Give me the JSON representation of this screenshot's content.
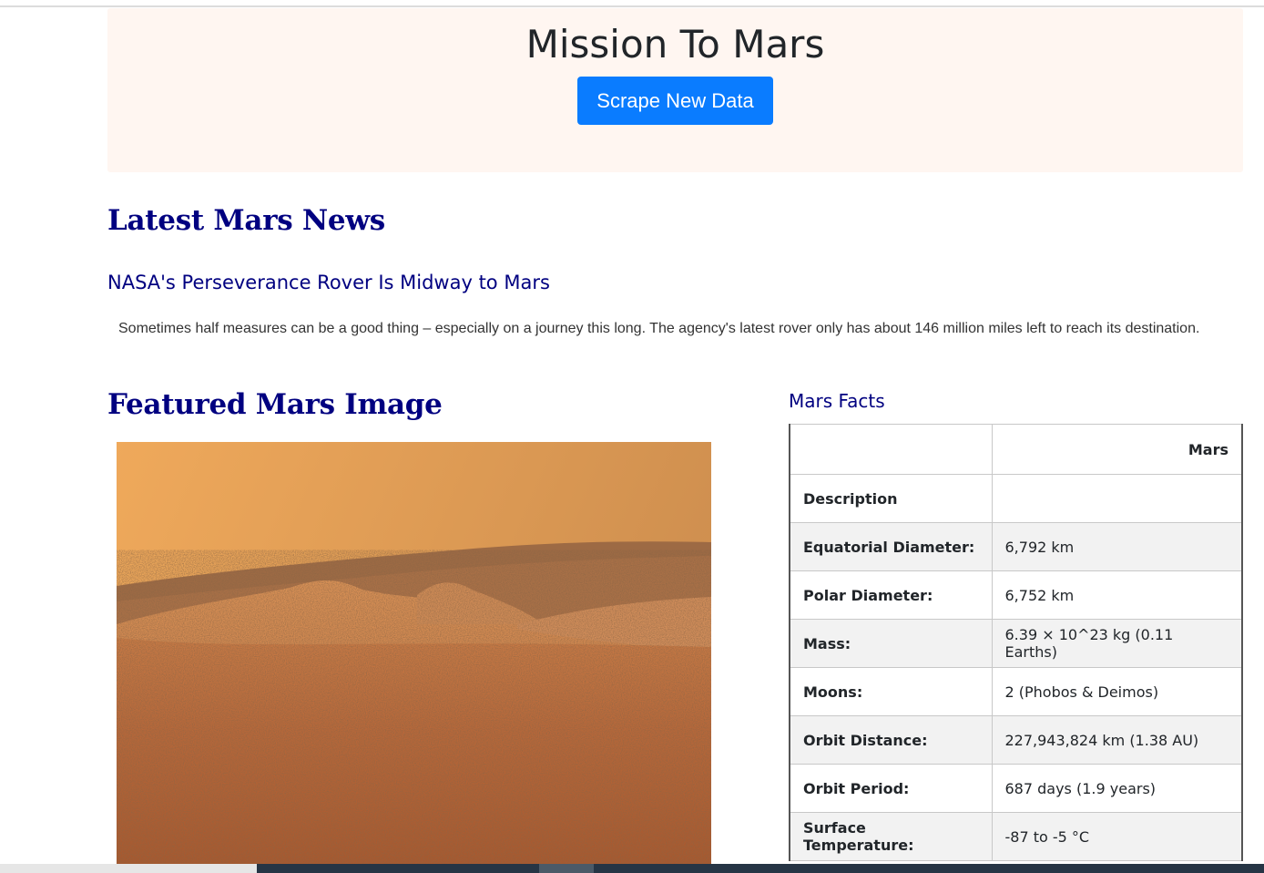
{
  "header": {
    "title": "Mission To Mars",
    "scrape_button": "Scrape New Data"
  },
  "news": {
    "section_title": "Latest Mars News",
    "headline": "NASA's Perseverance Rover Is Midway to Mars",
    "teaser": "Sometimes half measures can be a good thing – especially on a journey this long. The agency's latest rover only has about 146 million miles left to reach its destination."
  },
  "featured": {
    "section_title": "Featured Mars Image"
  },
  "facts": {
    "title": "Mars Facts",
    "column_header": "Mars",
    "rows": [
      {
        "label": "Description",
        "value": ""
      },
      {
        "label": "Equatorial Diameter:",
        "value": "6,792 km"
      },
      {
        "label": "Polar Diameter:",
        "value": "6,752 km"
      },
      {
        "label": "Mass:",
        "value": "6.39 × 10^23 kg (0.11 Earths)"
      },
      {
        "label": "Moons:",
        "value": "2 (Phobos & Deimos)"
      },
      {
        "label": "Orbit Distance:",
        "value": "227,943,824 km (1.38 AU)"
      },
      {
        "label": "Orbit Period:",
        "value": "687 days (1.9 years)"
      },
      {
        "label": "Surface Temperature:",
        "value": "-87 to -5 °C"
      }
    ]
  },
  "colors": {
    "heading": "#000080",
    "button": "#0a7cff",
    "jumbotron_bg": "#fff6f1"
  }
}
